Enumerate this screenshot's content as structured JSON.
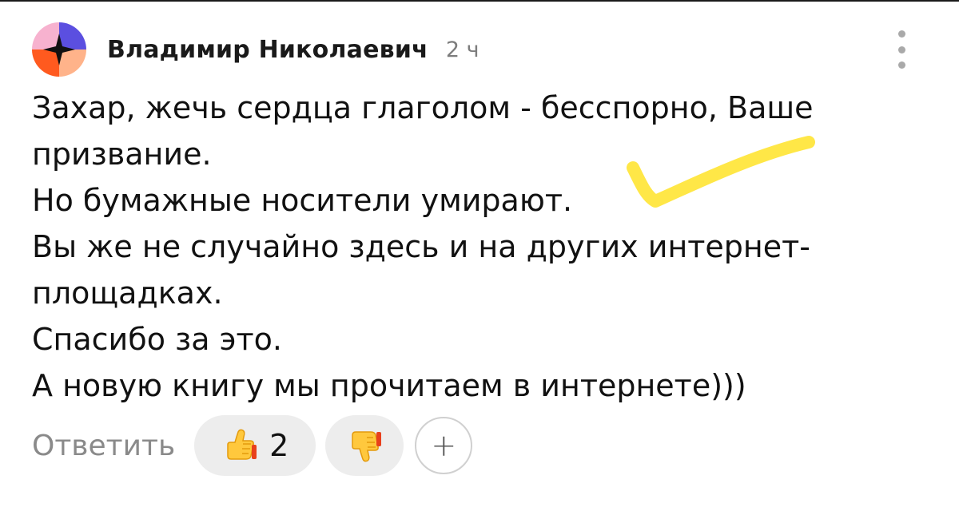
{
  "comment": {
    "author": "Владимир Николаевич",
    "time": "2 ч",
    "lines": [
      "Захар, жечь сердца глаголом - бесспорно, Ваше",
      "призвание.",
      "Но бумажные носители умирают.",
      "Вы же не случайно здесь и на других интернет-",
      "площадках.",
      "Спасибо за это.",
      "А новую книгу мы прочитаем в интернете)))"
    ]
  },
  "actions": {
    "reply_label": "Ответить",
    "like_count": "2",
    "plus_label": "+"
  },
  "icons": {
    "more": "more-vertical-icon",
    "like": "thumbs-up-icon",
    "dislike": "thumbs-down-icon"
  },
  "colors": {
    "author": "#1a1a1a",
    "time": "#7d7d7d",
    "reply": "#8a8a8a",
    "pill_bg": "#ededed",
    "highlight_check": "#ffe433"
  }
}
